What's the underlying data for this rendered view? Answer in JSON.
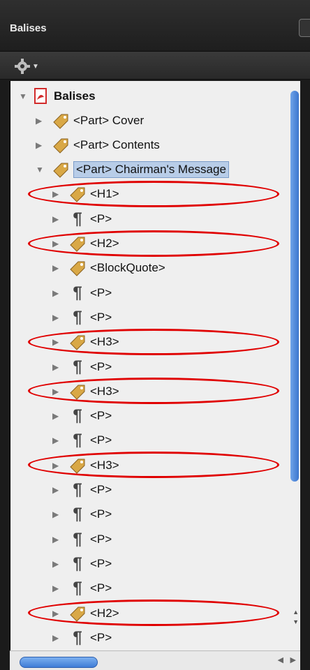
{
  "panel": {
    "title": "Balises"
  },
  "tree": {
    "root": "Balises",
    "rows": [
      {
        "label": "<Part> Cover",
        "icon": "tag-icon"
      },
      {
        "label": "<Part> Contents",
        "icon": "tag-icon"
      },
      {
        "label": "<Part> Chairman's Message",
        "icon": "tag-icon",
        "selected": true,
        "expanded": true
      },
      {
        "label": "<H1>",
        "icon": "tag-icon",
        "circled": true
      },
      {
        "label": "<P>",
        "icon": "paragraph-icon"
      },
      {
        "label": "<H2>",
        "icon": "tag-icon",
        "circled": true
      },
      {
        "label": "<BlockQuote>",
        "icon": "tag-icon"
      },
      {
        "label": "<P>",
        "icon": "paragraph-icon"
      },
      {
        "label": "<P>",
        "icon": "paragraph-icon"
      },
      {
        "label": "<H3>",
        "icon": "tag-icon",
        "circled": true
      },
      {
        "label": "<P>",
        "icon": "paragraph-icon"
      },
      {
        "label": "<H3>",
        "icon": "tag-icon",
        "circled": true
      },
      {
        "label": "<P>",
        "icon": "paragraph-icon"
      },
      {
        "label": "<P>",
        "icon": "paragraph-icon"
      },
      {
        "label": "<H3>",
        "icon": "tag-icon",
        "circled": true
      },
      {
        "label": "<P>",
        "icon": "paragraph-icon"
      },
      {
        "label": "<P>",
        "icon": "paragraph-icon"
      },
      {
        "label": "<P>",
        "icon": "paragraph-icon"
      },
      {
        "label": "<P>",
        "icon": "paragraph-icon"
      },
      {
        "label": "<P>",
        "icon": "paragraph-icon"
      },
      {
        "label": "<H2>",
        "icon": "tag-icon",
        "circled": true
      },
      {
        "label": "<P>",
        "icon": "paragraph-icon"
      }
    ]
  },
  "colors": {
    "annotation": "#e00000",
    "tag": "#d9a846",
    "pdf": "#d22b2b",
    "selection": "#b8cde8"
  }
}
